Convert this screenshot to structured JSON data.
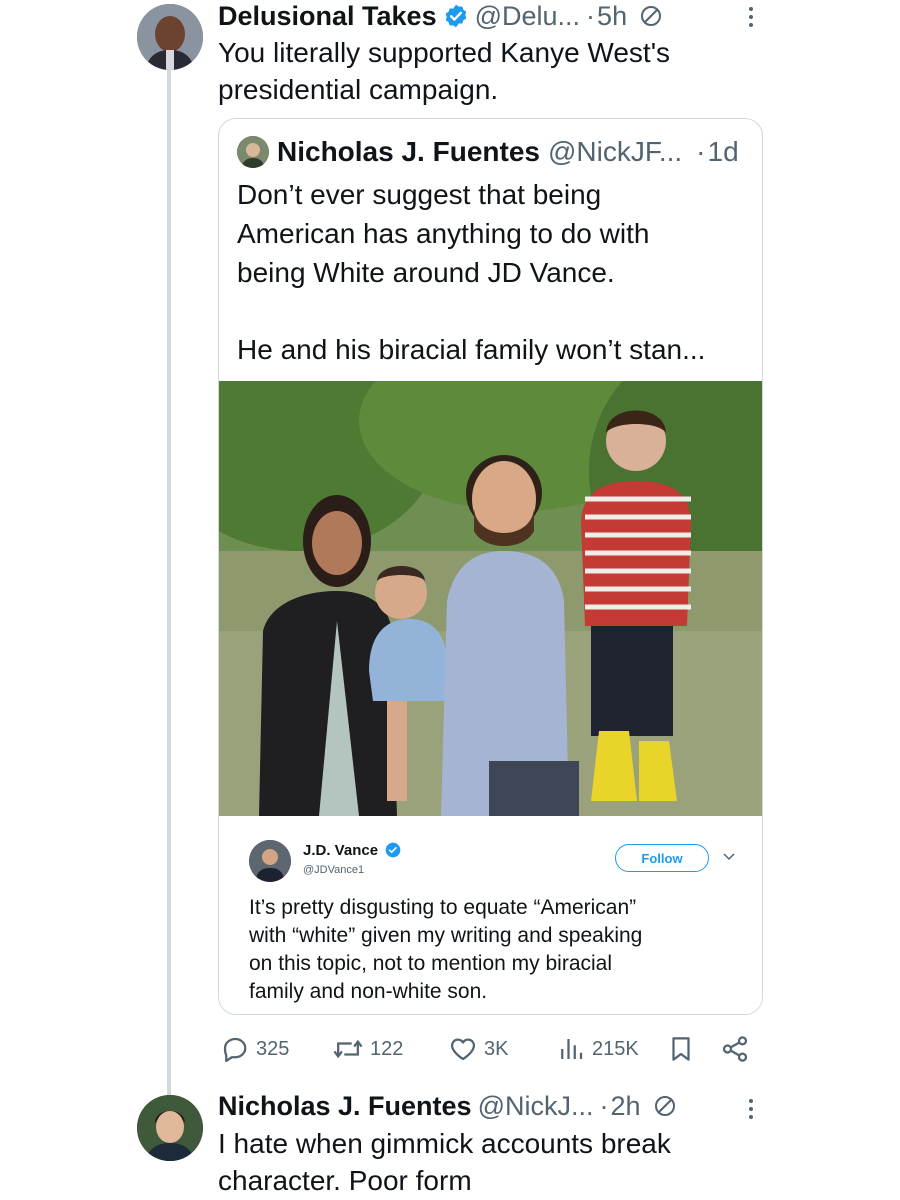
{
  "tweet_1": {
    "name": "Delusional Takes",
    "handle": "@Delu...",
    "dot": "·",
    "time": "5h",
    "text_lines": [
      "You literally supported Kanye West's",
      "presidential campaign."
    ]
  },
  "quoted_tweet": {
    "name": "Nicholas J. Fuentes",
    "handle": "@NickJF...",
    "dot": "·",
    "time": "1d",
    "paragraph_1": [
      "Don’t ever suggest that being",
      "American has anything to do with",
      "being White around JD Vance."
    ],
    "paragraph_2": [
      "He and his biracial family won’t stan..."
    ],
    "embedded_screenshot": {
      "name": "J.D. Vance",
      "handle": "@JDVance1",
      "follow_label": "Follow",
      "text_lines": [
        "It’s pretty disgusting to equate “American”",
        "with “white” given my writing and speaking",
        "on this topic, not to mention my biracial",
        "family and non-white son."
      ]
    }
  },
  "actions": {
    "replies": "325",
    "retweets": "122",
    "likes": "3K",
    "views": "215K"
  },
  "tweet_3": {
    "name": "Nicholas J. Fuentes",
    "handle": "@NickJ...",
    "dot": "·",
    "time": "2h",
    "text_lines": [
      "I hate when gimmick accounts break",
      "character. Poor form"
    ]
  },
  "colors": {
    "verified_blue": "#1d9bf0",
    "secondary_text": "#536471",
    "border": "#cfd9de"
  }
}
